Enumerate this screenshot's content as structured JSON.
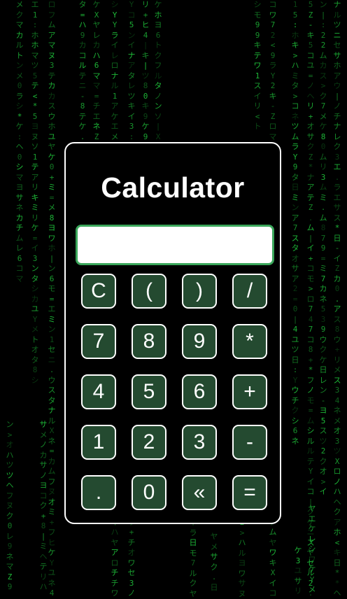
{
  "calculator": {
    "title": "Calculator",
    "display_value": "",
    "keys": [
      [
        "C",
        "(",
        ")",
        "/"
      ],
      [
        "7",
        "8",
        "9",
        "*"
      ],
      [
        "4",
        "5",
        "6",
        "+"
      ],
      [
        "1",
        "2",
        "3",
        "-"
      ],
      [
        ".",
        "0",
        "«",
        "="
      ]
    ]
  },
  "colors": {
    "background": "#000000",
    "rain": "#1fbf3a",
    "key_fill": "#244a30",
    "display_border": "#3aa65a",
    "border": "#ffffff"
  }
}
